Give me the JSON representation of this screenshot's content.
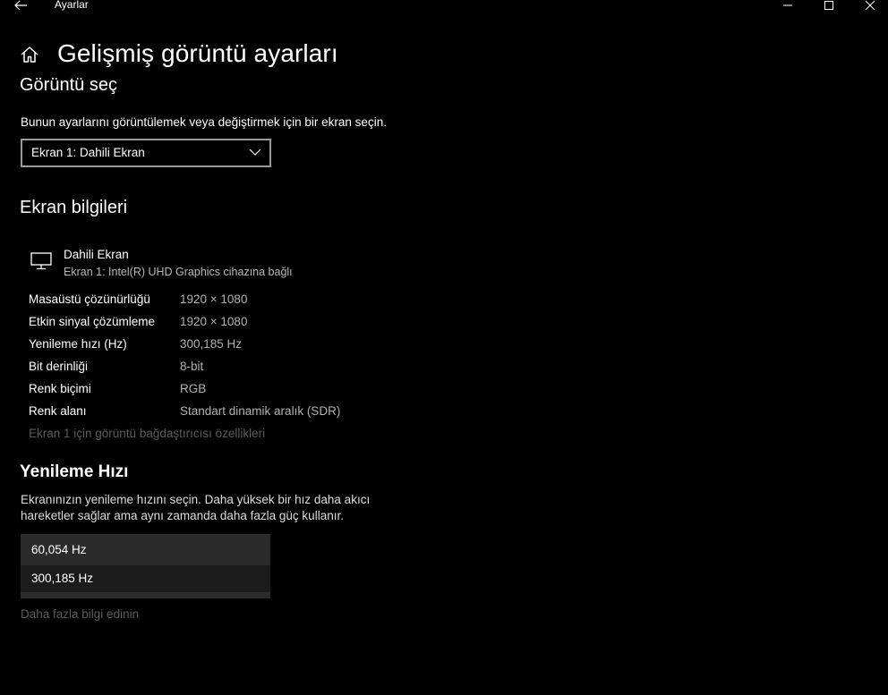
{
  "window": {
    "title": "Ayarlar"
  },
  "header": {
    "page_title": "Gelişmiş görüntü ayarları"
  },
  "select_display": {
    "section_title": "Görüntü seç",
    "description": "Bunun ayarlarını görüntülemek veya değiştirmek için bir ekran seçin.",
    "selected_value": "Ekran 1: Dahili Ekran"
  },
  "display_info": {
    "section_title": "Ekran bilgileri",
    "display_name": "Dahili Ekran",
    "display_subtitle": "Ekran 1: Intel(R) UHD Graphics cihazına bağlı",
    "rows": [
      {
        "label": "Masaüstü çözünürlüğü",
        "value": "1920 × 1080"
      },
      {
        "label": "Etkin sinyal çözümleme",
        "value": "1920 × 1080"
      },
      {
        "label": "Yenileme hızı (Hz)",
        "value": "300,185 Hz"
      },
      {
        "label": "Bit derinliği",
        "value": "8-bit"
      },
      {
        "label": "Renk biçimi",
        "value": "RGB"
      },
      {
        "label": "Renk alanı",
        "value": "Standart dinamik aralık (SDR)"
      }
    ],
    "adapter_link": "Ekran 1 için görüntü bağdaştırıcısı özellikleri"
  },
  "refresh_rate": {
    "section_title": "Yenileme Hızı",
    "description_line1": "Ekranınızın yenileme hızını seçin. Daha yüksek bir hız daha akıcı",
    "description_line2": "hareketler sağlar ama aynı zamanda daha fazla güç kullanır.",
    "options": [
      "60,054 Hz",
      "300,185 Hz"
    ],
    "learn_more_link": "Daha fazla bilgi edinin"
  },
  "icons": {
    "back": "back-arrow-icon",
    "minimize": "minimize-icon",
    "maximize": "maximize-icon",
    "close": "close-icon",
    "home": "home-icon",
    "chevron": "chevron-down-icon",
    "monitor": "monitor-icon"
  },
  "colors": {
    "background": "#000000",
    "text": "#ffffff",
    "secondary_text": "#b0b0b0",
    "disabled_text": "#5c5c5c",
    "dropdown_bg": "#2b2b2b"
  }
}
